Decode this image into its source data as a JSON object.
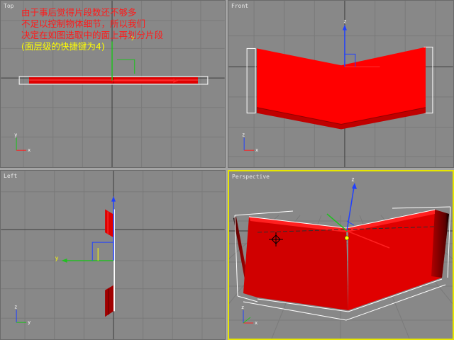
{
  "viewports": {
    "top": {
      "label": "Top"
    },
    "front": {
      "label": "Front"
    },
    "left": {
      "label": "Left"
    },
    "perspective": {
      "label": "Perspective"
    }
  },
  "annotation": {
    "line1": "由于事后觉得片段数还不够多",
    "line2": "不足以控制物体细节，所以我们",
    "line3": "决定在如图选取中的面上再划分片段",
    "line4": "(面层级的快捷键为4)"
  },
  "axis_labels": {
    "x": "x",
    "y": "y",
    "z": "z"
  },
  "colors": {
    "viewport_bg": "#888888",
    "grid": "#7a7a7a",
    "grid_major": "#3c3c3c",
    "object": "#ff0000",
    "active_border": "#e6e600",
    "annotation_red": "#ff1a1a",
    "annotation_yellow": "#ffff00",
    "gizmo_x": "#ff2020",
    "gizmo_y": "#20c020",
    "gizmo_z": "#2040ff"
  }
}
